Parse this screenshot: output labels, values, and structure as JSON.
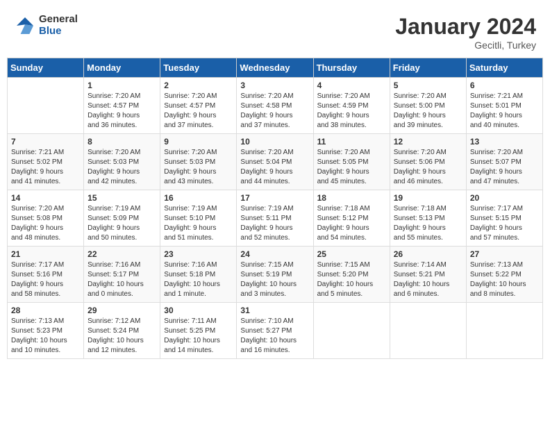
{
  "logo": {
    "general": "General",
    "blue": "Blue"
  },
  "title": "January 2024",
  "location": "Gecitli, Turkey",
  "days_header": [
    "Sunday",
    "Monday",
    "Tuesday",
    "Wednesday",
    "Thursday",
    "Friday",
    "Saturday"
  ],
  "weeks": [
    [
      {
        "day": "",
        "info": ""
      },
      {
        "day": "1",
        "info": "Sunrise: 7:20 AM\nSunset: 4:57 PM\nDaylight: 9 hours\nand 36 minutes."
      },
      {
        "day": "2",
        "info": "Sunrise: 7:20 AM\nSunset: 4:57 PM\nDaylight: 9 hours\nand 37 minutes."
      },
      {
        "day": "3",
        "info": "Sunrise: 7:20 AM\nSunset: 4:58 PM\nDaylight: 9 hours\nand 37 minutes."
      },
      {
        "day": "4",
        "info": "Sunrise: 7:20 AM\nSunset: 4:59 PM\nDaylight: 9 hours\nand 38 minutes."
      },
      {
        "day": "5",
        "info": "Sunrise: 7:20 AM\nSunset: 5:00 PM\nDaylight: 9 hours\nand 39 minutes."
      },
      {
        "day": "6",
        "info": "Sunrise: 7:21 AM\nSunset: 5:01 PM\nDaylight: 9 hours\nand 40 minutes."
      }
    ],
    [
      {
        "day": "7",
        "info": "Sunrise: 7:21 AM\nSunset: 5:02 PM\nDaylight: 9 hours\nand 41 minutes."
      },
      {
        "day": "8",
        "info": "Sunrise: 7:20 AM\nSunset: 5:03 PM\nDaylight: 9 hours\nand 42 minutes."
      },
      {
        "day": "9",
        "info": "Sunrise: 7:20 AM\nSunset: 5:03 PM\nDaylight: 9 hours\nand 43 minutes."
      },
      {
        "day": "10",
        "info": "Sunrise: 7:20 AM\nSunset: 5:04 PM\nDaylight: 9 hours\nand 44 minutes."
      },
      {
        "day": "11",
        "info": "Sunrise: 7:20 AM\nSunset: 5:05 PM\nDaylight: 9 hours\nand 45 minutes."
      },
      {
        "day": "12",
        "info": "Sunrise: 7:20 AM\nSunset: 5:06 PM\nDaylight: 9 hours\nand 46 minutes."
      },
      {
        "day": "13",
        "info": "Sunrise: 7:20 AM\nSunset: 5:07 PM\nDaylight: 9 hours\nand 47 minutes."
      }
    ],
    [
      {
        "day": "14",
        "info": "Sunrise: 7:20 AM\nSunset: 5:08 PM\nDaylight: 9 hours\nand 48 minutes."
      },
      {
        "day": "15",
        "info": "Sunrise: 7:19 AM\nSunset: 5:09 PM\nDaylight: 9 hours\nand 50 minutes."
      },
      {
        "day": "16",
        "info": "Sunrise: 7:19 AM\nSunset: 5:10 PM\nDaylight: 9 hours\nand 51 minutes."
      },
      {
        "day": "17",
        "info": "Sunrise: 7:19 AM\nSunset: 5:11 PM\nDaylight: 9 hours\nand 52 minutes."
      },
      {
        "day": "18",
        "info": "Sunrise: 7:18 AM\nSunset: 5:12 PM\nDaylight: 9 hours\nand 54 minutes."
      },
      {
        "day": "19",
        "info": "Sunrise: 7:18 AM\nSunset: 5:13 PM\nDaylight: 9 hours\nand 55 minutes."
      },
      {
        "day": "20",
        "info": "Sunrise: 7:17 AM\nSunset: 5:15 PM\nDaylight: 9 hours\nand 57 minutes."
      }
    ],
    [
      {
        "day": "21",
        "info": "Sunrise: 7:17 AM\nSunset: 5:16 PM\nDaylight: 9 hours\nand 58 minutes."
      },
      {
        "day": "22",
        "info": "Sunrise: 7:16 AM\nSunset: 5:17 PM\nDaylight: 10 hours\nand 0 minutes."
      },
      {
        "day": "23",
        "info": "Sunrise: 7:16 AM\nSunset: 5:18 PM\nDaylight: 10 hours\nand 1 minute."
      },
      {
        "day": "24",
        "info": "Sunrise: 7:15 AM\nSunset: 5:19 PM\nDaylight: 10 hours\nand 3 minutes."
      },
      {
        "day": "25",
        "info": "Sunrise: 7:15 AM\nSunset: 5:20 PM\nDaylight: 10 hours\nand 5 minutes."
      },
      {
        "day": "26",
        "info": "Sunrise: 7:14 AM\nSunset: 5:21 PM\nDaylight: 10 hours\nand 6 minutes."
      },
      {
        "day": "27",
        "info": "Sunrise: 7:13 AM\nSunset: 5:22 PM\nDaylight: 10 hours\nand 8 minutes."
      }
    ],
    [
      {
        "day": "28",
        "info": "Sunrise: 7:13 AM\nSunset: 5:23 PM\nDaylight: 10 hours\nand 10 minutes."
      },
      {
        "day": "29",
        "info": "Sunrise: 7:12 AM\nSunset: 5:24 PM\nDaylight: 10 hours\nand 12 minutes."
      },
      {
        "day": "30",
        "info": "Sunrise: 7:11 AM\nSunset: 5:25 PM\nDaylight: 10 hours\nand 14 minutes."
      },
      {
        "day": "31",
        "info": "Sunrise: 7:10 AM\nSunset: 5:27 PM\nDaylight: 10 hours\nand 16 minutes."
      },
      {
        "day": "",
        "info": ""
      },
      {
        "day": "",
        "info": ""
      },
      {
        "day": "",
        "info": ""
      }
    ]
  ]
}
